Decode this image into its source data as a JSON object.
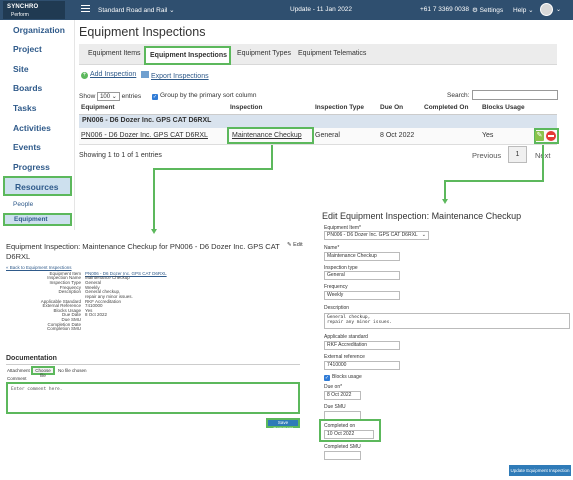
{
  "topbar": {
    "logo_top": "SYNCHRO",
    "logo_bottom": "Perform",
    "project": "Standard Road and Rail ⌄",
    "update": "Update - 11 Jan 2022",
    "phone": "+61 7 3369 0038",
    "settings": "⚙ Settings",
    "help": "Help ⌄",
    "avatar_chevron": "⌄"
  },
  "sidebar": {
    "items": [
      "Organization",
      "Project",
      "Site",
      "Boards",
      "Tasks",
      "Activities",
      "Events",
      "Progress"
    ],
    "resources": "Resources",
    "sub_items": [
      "People",
      "Equipment"
    ]
  },
  "main": {
    "title": "Equipment Inspections",
    "tabs": [
      "Equipment Items",
      "Equipment Inspections",
      "Equipment Types",
      "Equipment Telematics"
    ],
    "add_inspection": "Add Inspection",
    "export_inspections": "Export Inspections",
    "show_label": "Show",
    "show_value": "100 ⌄",
    "entries_label": "entries",
    "group_label": "Group by the primary sort column",
    "search_label": "Search:",
    "columns": [
      "Equipment",
      "Inspection",
      "Inspection Type",
      "Due On",
      "Completed On",
      "Blocks Usage"
    ],
    "group_row": "PN006 - D6 Dozer Inc. GPS CAT D6RXL",
    "row": {
      "equipment": "PN006 - D6 Dozer Inc. GPS CAT D6RXL",
      "inspection": "Maintenance Checkup",
      "type": "General",
      "due_on": "8 Oct 2022",
      "completed_on": "",
      "blocks_usage": "Yes"
    },
    "showing": "Showing 1 to 1 of 1 entries",
    "previous": "Previous",
    "page": "1",
    "next": "Next"
  },
  "detail": {
    "title": "Equipment Inspection: Maintenance Checkup for PN006 - D6 Dozer Inc. GPS CAT D6RXL",
    "edit": "✎ Edit",
    "back": "« Back to Equipment Inspections",
    "fields": [
      {
        "k": "Equipment Item",
        "v": "PN006 - D6 Dozer Inc. GPS CAT D6RXL"
      },
      {
        "k": "Inspection Name",
        "v": "Maintenance Checkup"
      },
      {
        "k": "Inspection Type",
        "v": "General"
      },
      {
        "k": "Frequency",
        "v": "Weekly"
      },
      {
        "k": "Description",
        "v": "General checkup,"
      },
      {
        "k": "",
        "v": "repair any minor issues."
      },
      {
        "k": "Applicable Standard",
        "v": "RKF Accreditation"
      },
      {
        "k": "External Reference",
        "v": "7410000"
      },
      {
        "k": "Blocks Usage",
        "v": "Yes"
      },
      {
        "k": "Due Date",
        "v": "8 Oct 2022"
      },
      {
        "k": "Due SMU",
        "v": ""
      },
      {
        "k": "Completion Date",
        "v": ""
      },
      {
        "k": "Completion SMU",
        "v": ""
      }
    ],
    "documentation": "Documentation",
    "attachment_label": "Attachment",
    "choose_file": "Choose file",
    "no_file": "No file chosen",
    "comment_label": "Comment",
    "comment_value": "Enter comment here.",
    "save_comment": "Save Comment"
  },
  "edit": {
    "title": "Edit Equipment Inspection: Maintenance Checkup",
    "equipment_item_label": "Equipment Item*",
    "equipment_item_value": "PN006 - D6 Dozer Inc. GPS CAT D6RXL",
    "name_label": "Name*",
    "name_value": "Maintenance Checkup",
    "inspection_type_label": "Inspection type",
    "inspection_type_value": "General",
    "frequency_label": "Frequency",
    "frequency_value": "Weekly",
    "description_label": "Description",
    "description_line1": "General checkup,",
    "description_line2": "repair any minor issues.",
    "standard_label": "Applicable standard",
    "standard_value": "RKF Accreditation",
    "external_ref_label": "External reference",
    "external_ref_value": "7410000",
    "blocks_usage_label": "Blocks usage",
    "due_on_label": "Due on*",
    "due_on_value": "8 Oct 2022",
    "due_smu_label": "Due SMU",
    "completed_on_label": "Completed on",
    "completed_on_value": "10 Oct 2022",
    "completed_smu_label": "Completed SMU",
    "update_button": "Update Equipment Inspection"
  },
  "colors": {
    "topbar": "#2f4f6f",
    "highlight": "#5cb85c",
    "link": "#2f5a8a",
    "button": "#2f7bb8"
  }
}
